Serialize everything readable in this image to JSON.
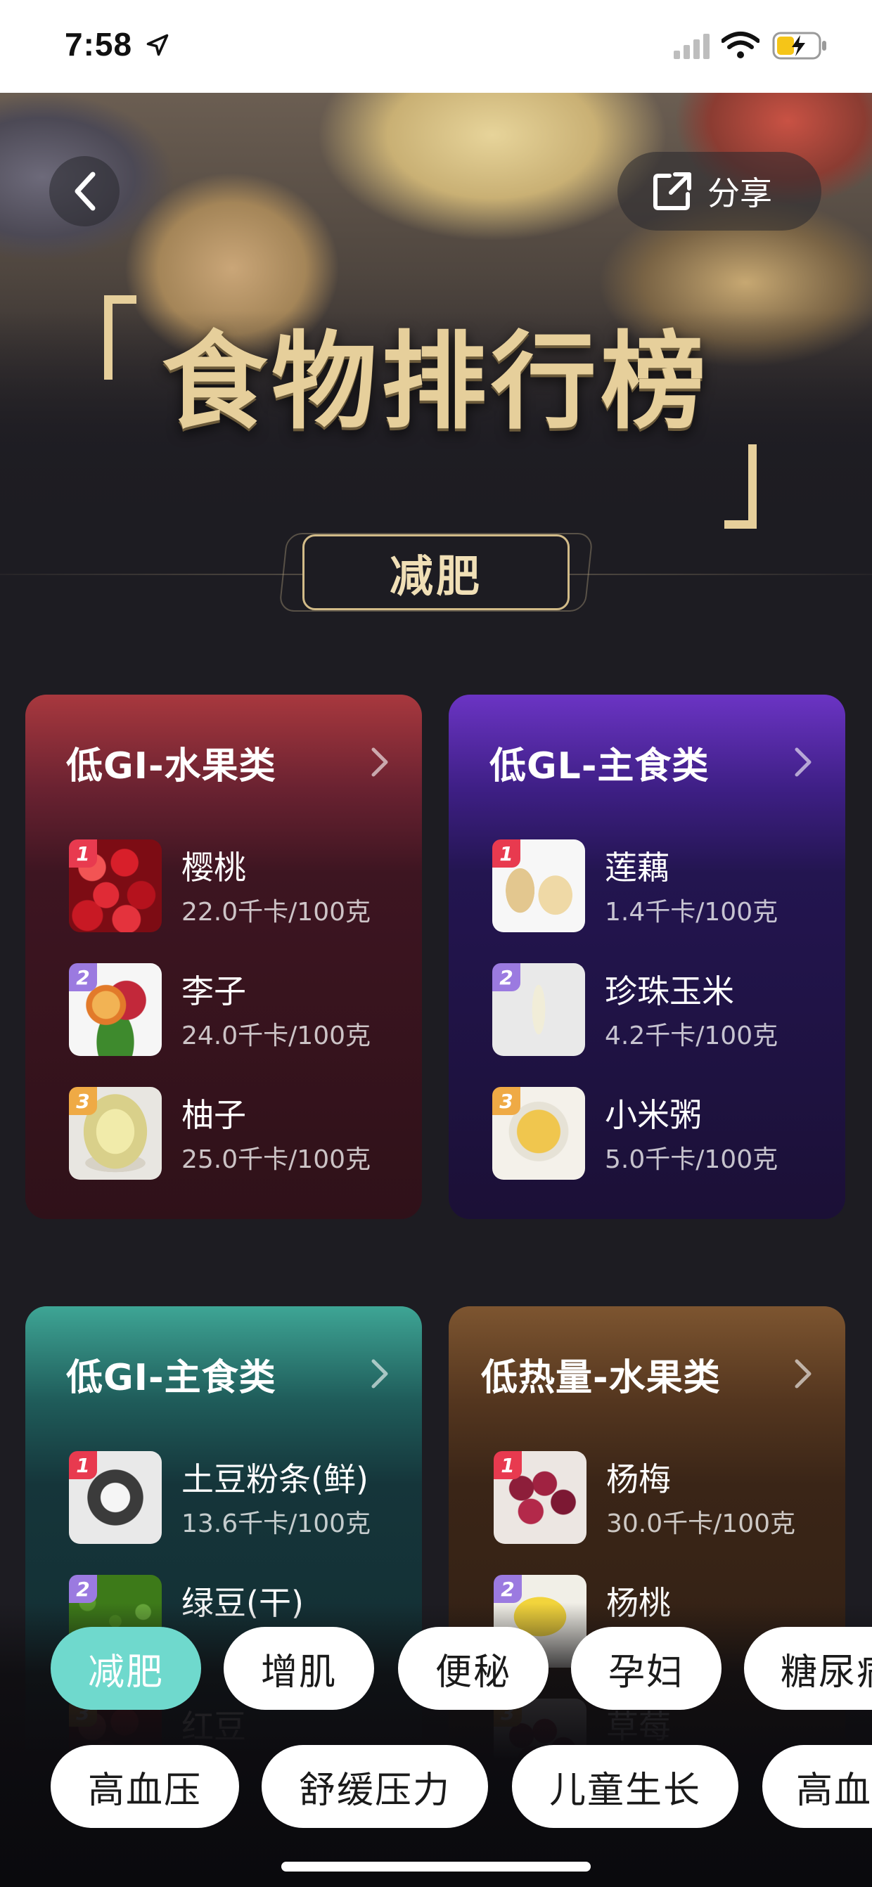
{
  "status_bar": {
    "time": "7:58"
  },
  "header": {
    "share_label": "分享",
    "title": "食物排行榜"
  },
  "section": {
    "label": "减肥"
  },
  "cards": [
    {
      "title": "低GI-水果类",
      "items": [
        {
          "rank": "1",
          "name": "樱桃",
          "calories": "22.0千卡/100克"
        },
        {
          "rank": "2",
          "name": "李子",
          "calories": "24.0千卡/100克"
        },
        {
          "rank": "3",
          "name": "柚子",
          "calories": "25.0千卡/100克"
        }
      ]
    },
    {
      "title": "低GL-主食类",
      "items": [
        {
          "rank": "1",
          "name": "莲藕",
          "calories": "1.4千卡/100克"
        },
        {
          "rank": "2",
          "name": "珍珠玉米",
          "calories": "4.2千卡/100克"
        },
        {
          "rank": "3",
          "name": "小米粥",
          "calories": "5.0千卡/100克"
        }
      ]
    },
    {
      "title": "低GI-主食类",
      "items": [
        {
          "rank": "1",
          "name": "土豆粉条(鲜)",
          "calories": "13.6千卡/100克"
        },
        {
          "rank": "2",
          "name": "绿豆(干)",
          "calories": ""
        },
        {
          "rank": "3",
          "name": "红豆",
          "calories": ""
        }
      ]
    },
    {
      "title": "低热量-水果类",
      "items": [
        {
          "rank": "1",
          "name": "杨梅",
          "calories": "30.0千卡/100克"
        },
        {
          "rank": "2",
          "name": "杨桃",
          "calories": ""
        },
        {
          "rank": "3",
          "name": "草莓",
          "calories": ""
        }
      ]
    }
  ],
  "categories_row1": [
    "减肥",
    "增肌",
    "便秘",
    "孕妇",
    "糖尿病"
  ],
  "categories_row2": [
    "高血压",
    "舒缓压力",
    "儿童生长",
    "高血脂"
  ],
  "colors": {
    "active_chip": "#6fd9cd",
    "gold_title": "#e6cf9b",
    "rank_1": "#e83a4f",
    "rank_2": "#9b7ae0",
    "rank_3": "#efaa45"
  },
  "icons": [
    "location-arrow-icon",
    "signal-icon",
    "wifi-icon",
    "battery-charging-icon",
    "back-icon",
    "share-icon",
    "chevron-right-icon"
  ]
}
